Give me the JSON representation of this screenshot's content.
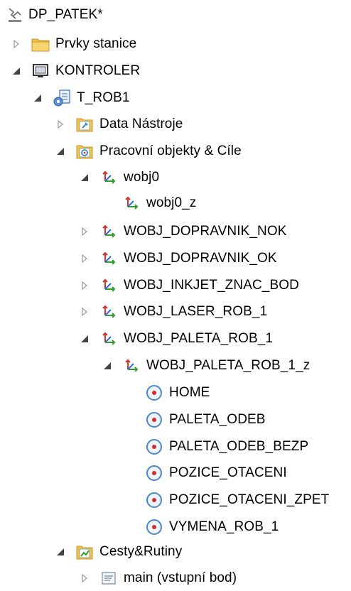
{
  "tree": {
    "station": {
      "label": "DP_PATEK*",
      "icon": "station-icon"
    },
    "station_items": {
      "label": "Prvky stanice",
      "icon": "folder-icon",
      "expanded": false
    },
    "controller": {
      "label": "KONTROLER",
      "icon": "controller-icon",
      "expanded": true
    },
    "task": {
      "label": "T_ROB1",
      "icon": "task-icon",
      "expanded": true
    },
    "tool_data": {
      "label": "Data Nástroje",
      "icon": "tool-data-icon",
      "expanded": false
    },
    "workobjects": {
      "label": "Pracovní objekty & Cíle",
      "icon": "workobjects-icon",
      "expanded": true
    },
    "wobj0": {
      "label": "wobj0",
      "icon": "frame-icon",
      "expanded": true
    },
    "wobj0_z": {
      "label": "wobj0_z",
      "icon": "frame-icon"
    },
    "wobj_dopravnik_nok": {
      "label": "WOBJ_DOPRAVNIK_NOK",
      "icon": "frame-icon",
      "expanded": false
    },
    "wobj_dopravnik_ok": {
      "label": "WOBJ_DOPRAVNIK_OK",
      "icon": "frame-icon",
      "expanded": false
    },
    "wobj_inkjet": {
      "label": "WOBJ_INKJET_ZNAC_BOD",
      "icon": "frame-icon",
      "expanded": false
    },
    "wobj_laser": {
      "label": "WOBJ_LASER_ROB_1",
      "icon": "frame-icon",
      "expanded": false
    },
    "wobj_paleta": {
      "label": "WOBJ_PALETA_ROB_1",
      "icon": "frame-icon",
      "expanded": true
    },
    "wobj_paleta_z": {
      "label": "WOBJ_PALETA_ROB_1_z",
      "icon": "frame-icon",
      "expanded": true
    },
    "targets": [
      {
        "label": "HOME",
        "icon": "target-icon"
      },
      {
        "label": "PALETA_ODEB",
        "icon": "target-icon"
      },
      {
        "label": "PALETA_ODEB_BEZP",
        "icon": "target-icon"
      },
      {
        "label": "POZICE_OTACENI",
        "icon": "target-icon"
      },
      {
        "label": "POZICE_OTACENI_ZPET",
        "icon": "target-icon"
      },
      {
        "label": "VYMENA_ROB_1",
        "icon": "target-icon"
      }
    ],
    "paths": {
      "label": "Cesty&Rutiny",
      "icon": "paths-icon",
      "expanded": true
    },
    "main": {
      "label": "main (vstupní bod)",
      "icon": "procedure-icon",
      "expanded": false
    }
  },
  "colors": {
    "frame_red": "#d9302a",
    "frame_green": "#2f9e2f",
    "frame_blue": "#2d6fd8",
    "target_ring": "#4d86c9",
    "target_dot": "#d52a2a",
    "folder_yellow": "#f4c14a"
  }
}
